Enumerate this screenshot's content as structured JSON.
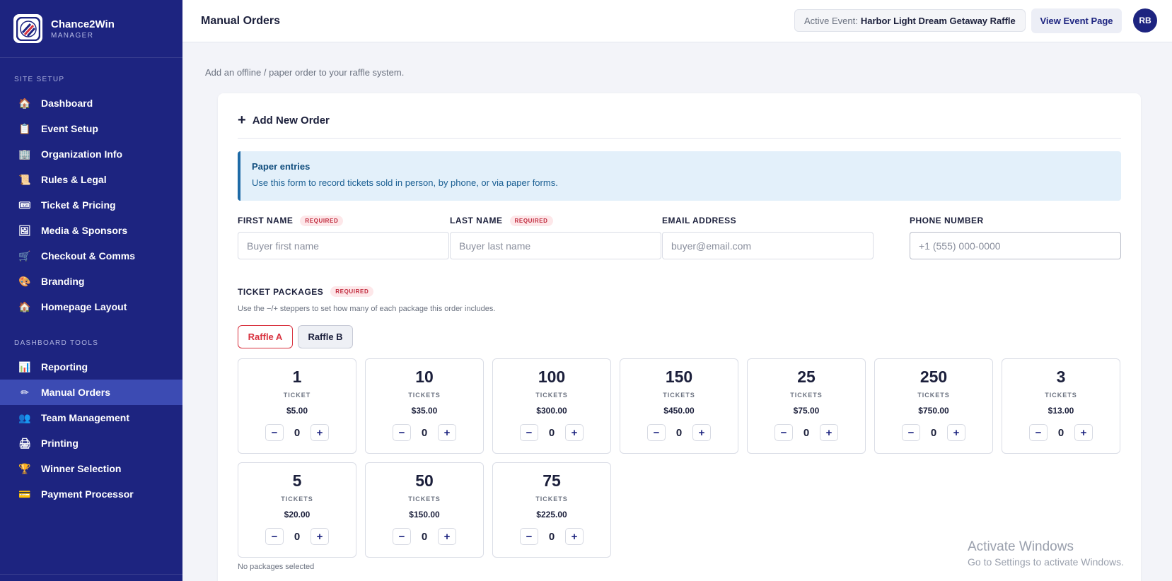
{
  "brand": {
    "name": "Chance2Win",
    "sub": "MANAGER"
  },
  "sidebar": {
    "section1": "SITE SETUP",
    "section2": "DASHBOARD TOOLS",
    "items1": [
      {
        "label": "Dashboard",
        "icon": "house-icon",
        "glyph": "🏠"
      },
      {
        "label": "Event Setup",
        "icon": "clipboard-icon",
        "glyph": "📋"
      },
      {
        "label": "Organization Info",
        "icon": "building-icon",
        "glyph": "🏢"
      },
      {
        "label": "Rules & Legal",
        "icon": "scroll-icon",
        "glyph": "📜"
      },
      {
        "label": "Ticket & Pricing",
        "icon": "ticket-icon",
        "glyph": "🎟"
      },
      {
        "label": "Media & Sponsors",
        "icon": "picture-icon",
        "glyph": "🖼"
      },
      {
        "label": "Checkout & Comms",
        "icon": "cart-icon",
        "glyph": "🛒"
      },
      {
        "label": "Branding",
        "icon": "palette-icon",
        "glyph": "🎨"
      },
      {
        "label": "Homepage Layout",
        "icon": "house-icon",
        "glyph": "🏠"
      }
    ],
    "items2": [
      {
        "label": "Reporting",
        "icon": "bar-chart-icon",
        "glyph": "📊"
      },
      {
        "label": "Manual Orders",
        "icon": "pen-icon",
        "glyph": "✏"
      },
      {
        "label": "Team Management",
        "icon": "people-icon",
        "glyph": "👥"
      },
      {
        "label": "Printing",
        "icon": "printer-icon",
        "glyph": "🖨"
      },
      {
        "label": "Winner Selection",
        "icon": "trophy-icon",
        "glyph": "🏆"
      },
      {
        "label": "Payment Processor",
        "icon": "credit-card-icon",
        "glyph": "💳"
      }
    ]
  },
  "header": {
    "title": "Manual Orders",
    "active_event_label": "Active Event:",
    "active_event_name": "Harbor Light Dream Getaway Raffle",
    "view_event": "View Event Page",
    "avatar": "RB"
  },
  "main": {
    "subtitle": "Add an offline / paper order to your raffle system.",
    "card_title": "Add New Order",
    "notice_title": "Paper entries",
    "notice_body": "Use this form to record tickets sold in person, by phone, or via paper forms.",
    "required_badge": "REQUIRED",
    "fields": {
      "first_name": {
        "label": "FIRST NAME",
        "placeholder": "Buyer first name"
      },
      "last_name": {
        "label": "LAST NAME",
        "placeholder": "Buyer last name"
      },
      "email": {
        "label": "EMAIL ADDRESS",
        "placeholder": "buyer@email.com"
      },
      "phone": {
        "label": "PHONE NUMBER",
        "placeholder": "+1 (555) 000-0000"
      }
    },
    "packages_label": "TICKET PACKAGES",
    "packages_help": "Use the −/+ steppers to set how many of each package this order includes.",
    "raffle_tabs": [
      "Raffle A",
      "Raffle B"
    ],
    "packages": [
      {
        "count": "1",
        "unit": "TICKET",
        "price": "$5.00",
        "qty": "0"
      },
      {
        "count": "10",
        "unit": "TICKETS",
        "price": "$35.00",
        "qty": "0"
      },
      {
        "count": "100",
        "unit": "TICKETS",
        "price": "$300.00",
        "qty": "0"
      },
      {
        "count": "150",
        "unit": "TICKETS",
        "price": "$450.00",
        "qty": "0"
      },
      {
        "count": "25",
        "unit": "TICKETS",
        "price": "$75.00",
        "qty": "0"
      },
      {
        "count": "250",
        "unit": "TICKETS",
        "price": "$750.00",
        "qty": "0"
      },
      {
        "count": "3",
        "unit": "TICKETS",
        "price": "$13.00",
        "qty": "0"
      },
      {
        "count": "5",
        "unit": "TICKETS",
        "price": "$20.00",
        "qty": "0"
      },
      {
        "count": "50",
        "unit": "TICKETS",
        "price": "$150.00",
        "qty": "0"
      },
      {
        "count": "75",
        "unit": "TICKETS",
        "price": "$225.00",
        "qty": "0"
      }
    ],
    "minus": "−",
    "plus": "+",
    "no_packages": "No packages selected"
  },
  "watermark": {
    "line1": "Activate Windows",
    "line2": "Go to Settings to activate Windows."
  },
  "colors": {
    "sidebar": "#1d2480",
    "active_nav": "#3c4bb3",
    "accent_red": "#d8323f",
    "notice_bg": "#e3f0fa"
  }
}
